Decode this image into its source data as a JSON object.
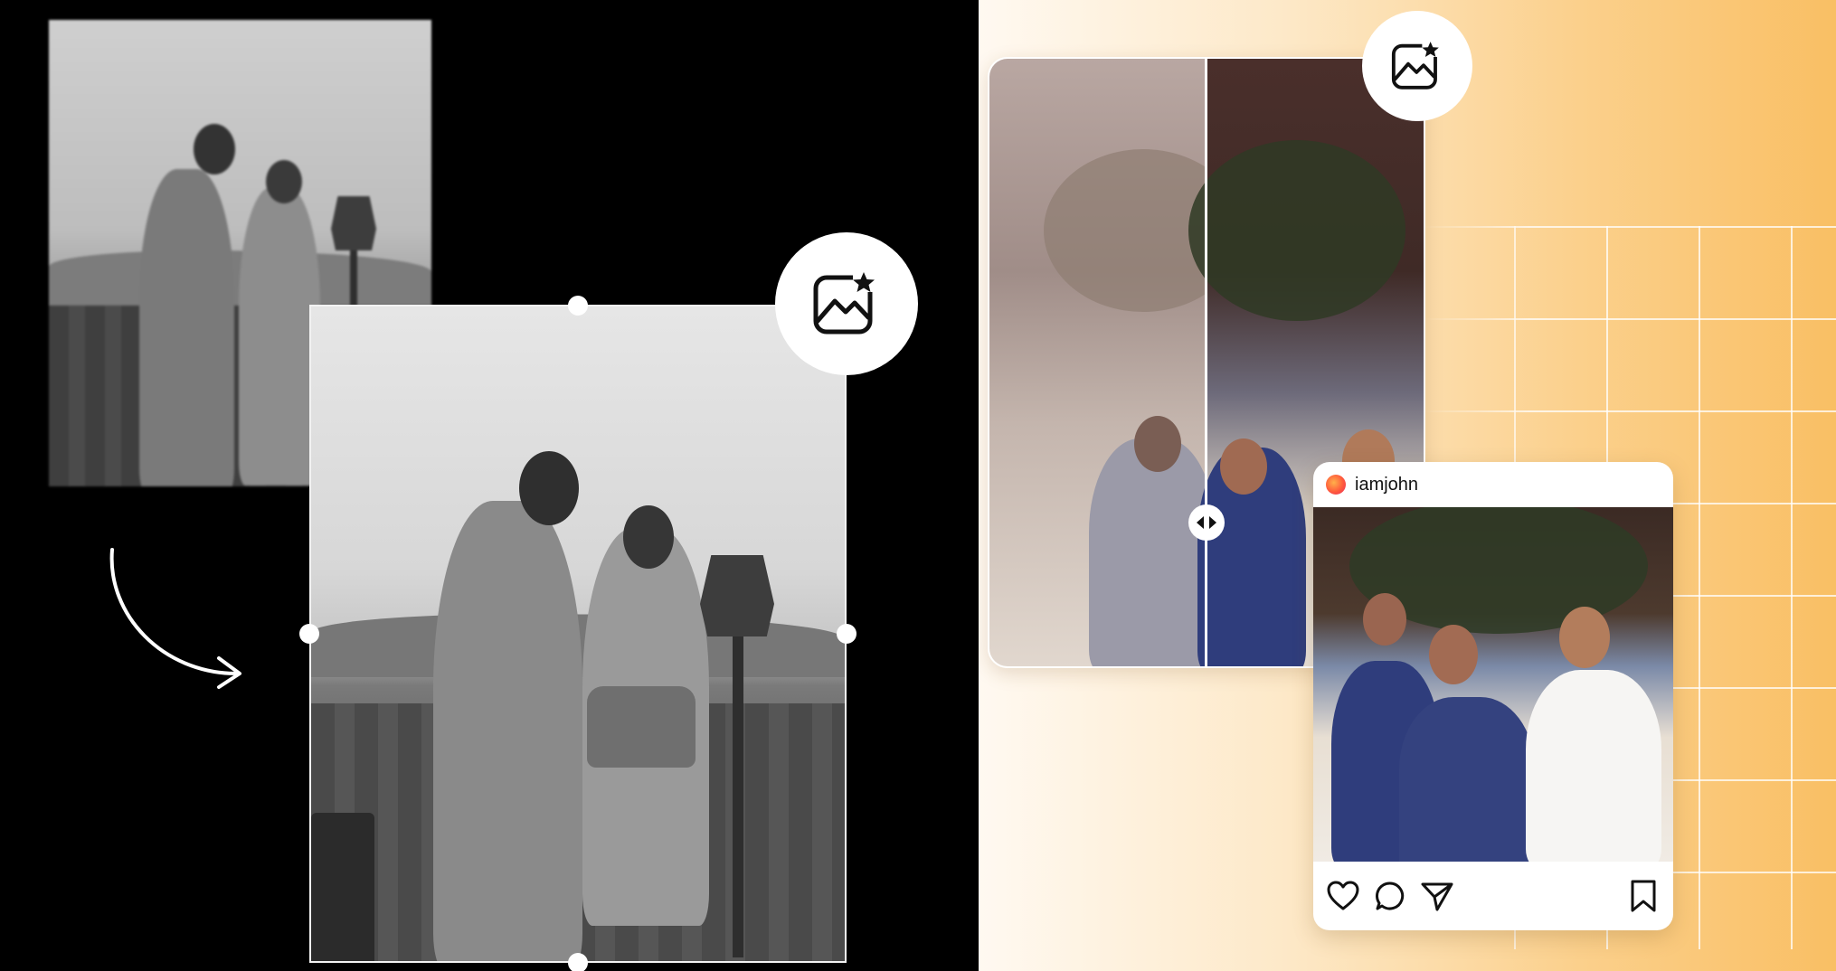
{
  "left": {
    "icons": {
      "enhance": "image-sparkle-icon",
      "arrow": "curved-arrow-icon"
    }
  },
  "right": {
    "icons": {
      "enhance": "image-sparkle-icon",
      "compare": "left-right-arrows-icon"
    },
    "post": {
      "username": "iamjohn",
      "actions": [
        "heart-icon",
        "comment-icon",
        "share-icon",
        "bookmark-icon"
      ]
    }
  }
}
